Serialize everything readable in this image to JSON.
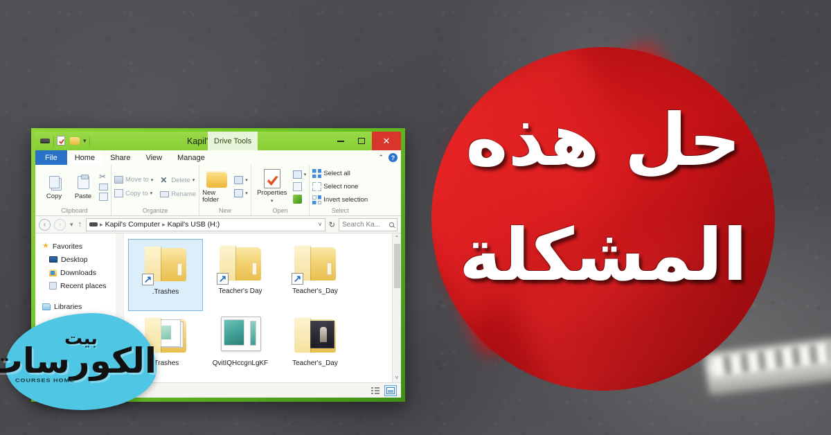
{
  "headline": {
    "line1": "حل هذه",
    "line2": "المشكلة"
  },
  "brand": {
    "top": "بيت",
    "main": "الكورسات",
    "sub": "COURSES HOME"
  },
  "colors": {
    "circle_red": "#b01114",
    "ribbon_green": "#8ad037",
    "close_red": "#d9362b",
    "brand_cyan": "#4fc6e4",
    "selection_blue": "#ddeefb"
  },
  "explorer": {
    "titlebar": {
      "title": "Kapil's USB (H:)",
      "contextual_tab": "Drive Tools",
      "quick_access": [
        "drive-icon",
        "properties-icon",
        "new-folder-icon",
        "chevron-down-icon"
      ],
      "controls": {
        "minimize": "–",
        "maximize": "□",
        "close": "✕"
      }
    },
    "tabs": [
      {
        "label": "File",
        "state": "file"
      },
      {
        "label": "Home",
        "state": "active"
      },
      {
        "label": "Share",
        "state": "normal"
      },
      {
        "label": "View",
        "state": "normal"
      },
      {
        "label": "Manage",
        "state": "normal"
      }
    ],
    "ribbon_right": {
      "collapse": "⌃",
      "help": "?"
    },
    "ribbon": {
      "groups": [
        {
          "name": "Clipboard",
          "big": [
            {
              "label": "Copy",
              "icon": "copy-icon"
            },
            {
              "label": "Paste",
              "icon": "paste-icon"
            }
          ],
          "small": [
            {
              "label": "",
              "icon": "cut-icon",
              "enabled": true
            },
            {
              "label": "",
              "icon": "copy-path-icon",
              "enabled": true
            },
            {
              "label": "",
              "icon": "paste-shortcut-icon",
              "enabled": true
            }
          ]
        },
        {
          "name": "Organize",
          "small": [
            {
              "label": "Move to",
              "icon": "move-to-icon",
              "dropdown": "▾",
              "enabled": false
            },
            {
              "label": "Copy to",
              "icon": "copy-to-icon",
              "dropdown": "▾",
              "enabled": false
            },
            {
              "label": "Delete",
              "icon": "delete-icon",
              "dropdown": "▾",
              "enabled": false
            },
            {
              "label": "Rename",
              "icon": "rename-icon",
              "dropdown": "",
              "enabled": false
            }
          ]
        },
        {
          "name": "New",
          "big": [
            {
              "label": "New folder",
              "icon": "new-folder-icon"
            }
          ],
          "small": [
            {
              "label": "",
              "icon": "new-item-icon",
              "dropdown": "▾",
              "enabled": true
            },
            {
              "label": "",
              "icon": "easy-access-icon",
              "dropdown": "▾",
              "enabled": true
            }
          ]
        },
        {
          "name": "Open",
          "big": [
            {
              "label": "Properties",
              "icon": "properties-icon",
              "dropdown": "▾"
            }
          ],
          "small": [
            {
              "label": "",
              "icon": "open-icon",
              "dropdown": "▾",
              "enabled": true
            },
            {
              "label": "",
              "icon": "edit-icon",
              "dropdown": "",
              "enabled": true
            },
            {
              "label": "",
              "icon": "history-icon",
              "dropdown": "",
              "enabled": true
            }
          ]
        },
        {
          "name": "Select",
          "small": [
            {
              "label": "Select all",
              "icon": "select-all-icon",
              "enabled": true
            },
            {
              "label": "Select none",
              "icon": "select-none-icon",
              "enabled": true
            },
            {
              "label": "Invert selection",
              "icon": "invert-selection-icon",
              "enabled": true
            }
          ]
        }
      ]
    },
    "addressbar": {
      "back": "‹",
      "forward": "›",
      "recent": "▾",
      "up": "↑",
      "crumbs": [
        "Kapil's Computer",
        "Kapil's USB (H:)"
      ],
      "crumb_separator": "▸",
      "dropdown": "˅",
      "refresh": "↻",
      "search_placeholder": "Search Ka..."
    },
    "navpane": {
      "items": [
        {
          "label": "Favorites",
          "icon": "star-icon",
          "level": 0
        },
        {
          "label": "Desktop",
          "icon": "desktop-icon",
          "level": 1
        },
        {
          "label": "Downloads",
          "icon": "downloads-icon",
          "level": 1
        },
        {
          "label": "Recent places",
          "icon": "recent-places-icon",
          "level": 1
        },
        {
          "label": "Libraries",
          "icon": "libraries-icon",
          "level": 0
        }
      ]
    },
    "files": [
      {
        "name": ".Trashes",
        "type": "folder-shortcut",
        "selected": true
      },
      {
        "name": "Teacher's Day",
        "type": "folder-shortcut",
        "selected": false
      },
      {
        "name": "Teacher's_Day",
        "type": "folder-shortcut",
        "selected": false
      },
      {
        "name": ".Trashes",
        "type": "folder-papers",
        "selected": false
      },
      {
        "name": "QvitIQHccgnLgKF",
        "type": "image-file",
        "selected": false
      },
      {
        "name": "Teacher's_Day",
        "type": "folder-photo",
        "selected": false
      }
    ],
    "statusbar": {
      "views": [
        {
          "name": "details-view",
          "active": false
        },
        {
          "name": "large-icons-view",
          "active": true
        }
      ]
    },
    "scroll": {
      "up": "⌃",
      "down": "˅"
    }
  }
}
